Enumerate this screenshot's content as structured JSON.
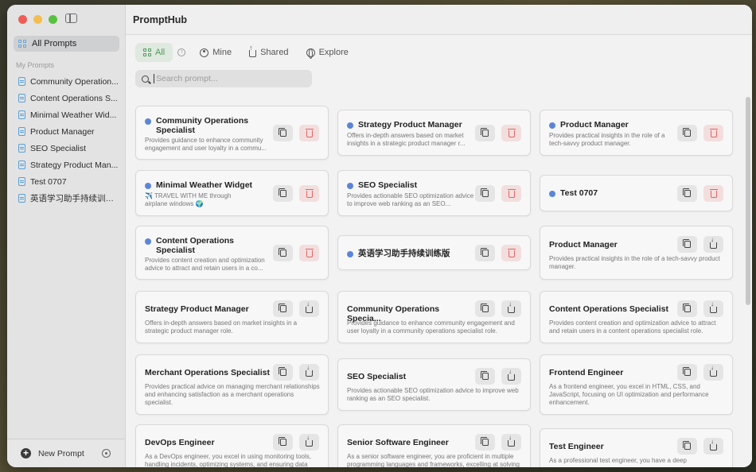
{
  "app": {
    "title": "PromptHub"
  },
  "sidebar": {
    "all_label": "All Prompts",
    "section_label": "My Prompts",
    "items": [
      {
        "label": "Community Operation..."
      },
      {
        "label": "Content Operations S..."
      },
      {
        "label": "Minimal Weather Wid..."
      },
      {
        "label": "Product Manager"
      },
      {
        "label": "SEO Specialist"
      },
      {
        "label": "Strategy Product Man..."
      },
      {
        "label": "Test 0707"
      },
      {
        "label": "英语学习助手持续训练版"
      }
    ],
    "new_prompt_label": "New Prompt"
  },
  "tabs": [
    {
      "label": "All",
      "active": true
    },
    {
      "label": "Mine"
    },
    {
      "label": "Shared"
    },
    {
      "label": "Explore"
    }
  ],
  "search": {
    "placeholder": "Search prompt...",
    "value": ""
  },
  "cards": [
    {
      "title": "Community Operations Specialist",
      "desc": "Provides guidance to enhance community engagement and user loyalty in a commu...",
      "own": true
    },
    {
      "title": "Strategy Product Manager",
      "desc": "Offers in-depth answers based on market insights in a strategic product manager r...",
      "own": true
    },
    {
      "title": "Product Manager",
      "desc": "Provides practical insights in the role of a tech-savvy product manager.",
      "own": true
    },
    {
      "title": "Minimal Weather Widget",
      "desc": "✈️ TRAVEL WITH ME  through airplane windows 🌍",
      "own": true
    },
    {
      "title": "SEO Specialist",
      "desc": "Provides actionable SEO optimization advice to improve web ranking as an SEO...",
      "own": true
    },
    {
      "title": "Test 0707",
      "desc": "",
      "own": true
    },
    {
      "title": "Content Operations Specialist",
      "desc": "Provides content creation and optimization advice to attract and retain users in a co...",
      "own": true
    },
    {
      "title": "英语学习助手持续训练版",
      "desc": "",
      "own": true
    },
    {
      "title": "Product Manager",
      "desc": "Provides practical insights in the role of a tech-savvy product manager.",
      "own": false
    },
    {
      "title": "Strategy Product Manager",
      "desc": "Offers in-depth answers based on market insights in a strategic product manager role.",
      "own": false
    },
    {
      "title": "Community Operations Specia...",
      "desc": "Provides guidance to enhance community engagement and user loyalty in a community operations specialist role.",
      "own": false
    },
    {
      "title": "Content Operations Specialist",
      "desc": "Provides content creation and optimization advice to attract and retain users in a content operations specialist role.",
      "own": false
    },
    {
      "title": "Merchant Operations Specialist",
      "desc": "Provides practical advice on managing merchant relationships and enhancing satisfaction as a merchant operations specialist.",
      "own": false
    },
    {
      "title": "SEO Specialist",
      "desc": "Provides actionable SEO optimization advice to improve web ranking as an SEO specialist.",
      "own": false
    },
    {
      "title": "Frontend Engineer",
      "desc": "As a frontend engineer, you excel in HTML, CSS, and JavaScript, focusing on UI optimization and performance enhancement.",
      "own": false
    },
    {
      "title": "DevOps Engineer",
      "desc": "As a DevOps engineer, you excel in using monitoring tools, handling incidents, optimizing systems, and ensuring data",
      "own": false
    },
    {
      "title": "Senior Software Engineer",
      "desc": "As a senior software engineer, you are proficient in multiple programming languages and frameworks, excelling at solving",
      "own": false
    },
    {
      "title": "Test Engineer",
      "desc": "As a professional test engineer, you have a deep",
      "own": false
    }
  ],
  "colors": {
    "accent": "#4f9a58",
    "delete": "#e06565",
    "avatar": "#5b86d8"
  }
}
